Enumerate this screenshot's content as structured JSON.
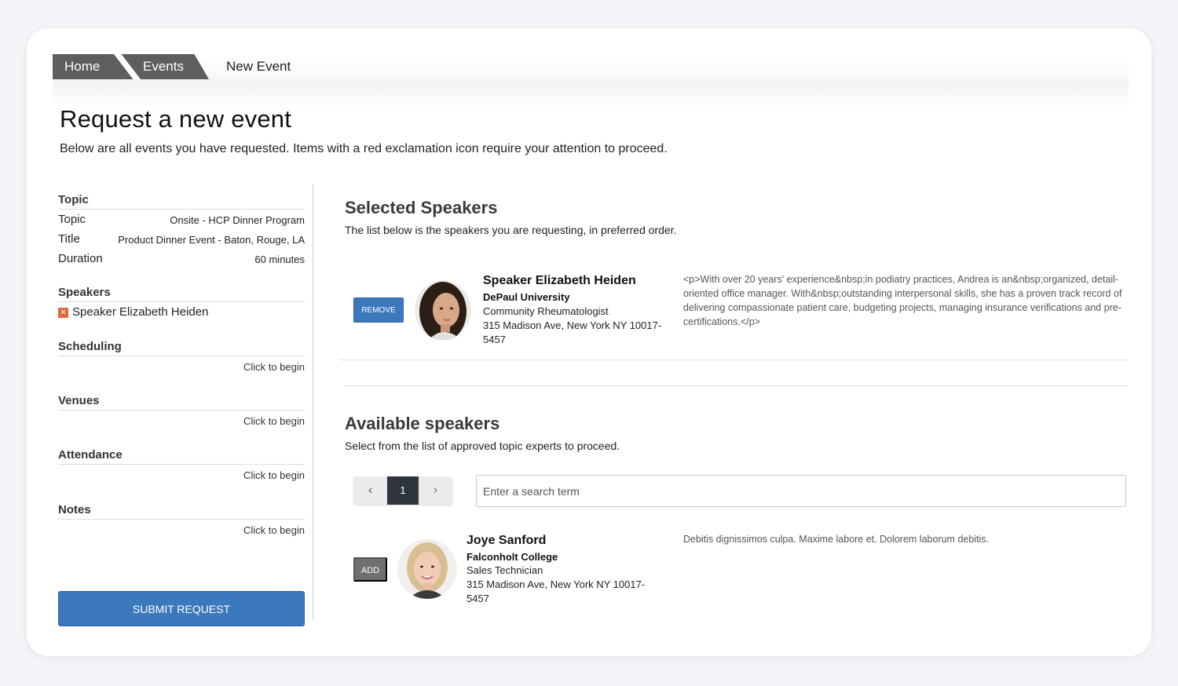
{
  "breadcrumb": {
    "home": "Home",
    "events": "Events",
    "current": "New Event"
  },
  "header": {
    "title": "Request a new event",
    "subtitle": "Below are all events you have requested. Items with a red exclamation icon require your attention to proceed."
  },
  "sidebar": {
    "topic_section": "Topic",
    "topic_label": "Topic",
    "topic_value": "Onsite - HCP Dinner Program",
    "title_label": "Title",
    "title_value": "Product Dinner Event - Baton, Rouge, LA",
    "duration_label": "Duration",
    "duration_value": "60 minutes",
    "speakers_section": "Speakers",
    "speaker_name": "Speaker Elizabeth Heiden",
    "scheduling_section": "Scheduling",
    "scheduling_action": "Click to begin",
    "venues_section": "Venues",
    "venues_action": "Click to begin",
    "attendance_section": "Attendance",
    "attendance_action": "Click to begin",
    "notes_section": "Notes",
    "notes_action": "Click to begin",
    "submit_label": "SUBMIT REQUEST"
  },
  "selected": {
    "title": "Selected Speakers",
    "subtitle": "The list below is the speakers you are requesting, in preferred order.",
    "remove_label": "REMOVE",
    "speaker": {
      "name": "Speaker Elizabeth Heiden",
      "school": "DePaul University",
      "role": "Community Rheumatologist",
      "address1": "315 Madison Ave, New York NY 10017-",
      "address2": "5457",
      "bio": "<p>With over 20 years' experience&nbsp;in podiatry practices, Andrea is an&nbsp;organized, detail-oriented office manager. With&nbsp;outstanding interpersonal skills, she has a proven track record of delivering compassionate patient care, budgeting projects, managing insurance verifications and pre-certifications.</p>"
    }
  },
  "available": {
    "title": "Available speakers",
    "subtitle": "Select from the list of approved topic experts to proceed.",
    "pager": {
      "prev": "‹",
      "current": "1",
      "next": "›"
    },
    "search_placeholder": "Enter a search term",
    "add_label": "ADD",
    "speaker": {
      "name": "Joye Sanford",
      "school": "Falconholt College",
      "role": "Sales Technician",
      "address1": "315 Madison Ave, New York NY 10017-",
      "address2": "5457",
      "bio": "Debitis dignissimos culpa. Maxime labore et. Dolorem laborum debitis."
    }
  },
  "colors": {
    "primary": "#3b78bc",
    "breadcrumb": "#5e5e5e",
    "alert": "#e0683a",
    "pager_active": "#2f3640"
  }
}
